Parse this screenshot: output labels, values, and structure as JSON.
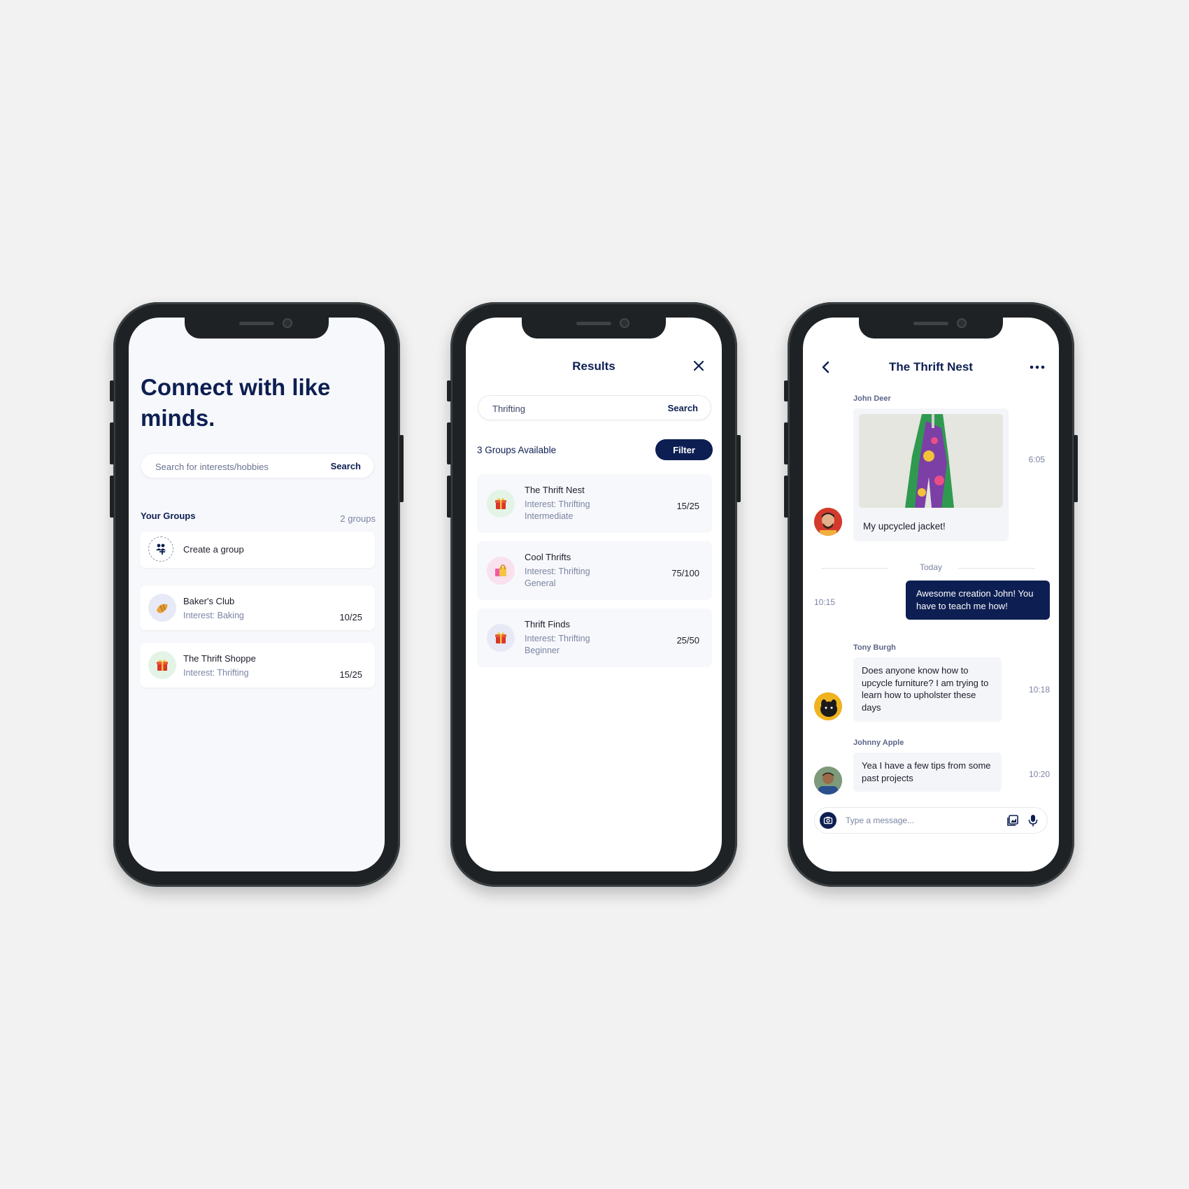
{
  "colors": {
    "navy": "#0d1f52",
    "muted_text": "#7b84a3",
    "card_bg": "#ffffff",
    "screen_bg": "#f7f8fb"
  },
  "screen1": {
    "title": "Connect with like minds.",
    "search": {
      "placeholder": "Search for interests/hobbies",
      "button": "Search"
    },
    "your_groups_label": "Your Groups",
    "groups_count": "2 groups",
    "create_group": {
      "label": "Create a group",
      "icon": "add-group-icon"
    },
    "groups": [
      {
        "name": "Baker's Club",
        "interest": "Interest: Baking",
        "members": "10/25",
        "icon": "croissant-icon"
      },
      {
        "name": "The Thrift Shoppe",
        "interest": "Interest: Thrifting",
        "members": "15/25",
        "icon": "gift-icon"
      }
    ]
  },
  "screen2": {
    "header": "Results",
    "search": {
      "value": "Thrifting",
      "button": "Search"
    },
    "available": "3 Groups Available",
    "filter": "Filter",
    "results": [
      {
        "name": "The Thrift Nest",
        "interest": "Interest: Thrifting",
        "level": "Intermediate",
        "members": "15/25",
        "icon": "gift-icon"
      },
      {
        "name": "Cool Thrifts",
        "interest": "Interest: Thrifting",
        "level": "General",
        "members": "75/100",
        "icon": "shopping-bags-icon"
      },
      {
        "name": "Thrift Finds",
        "interest": "Interest: Thrifting",
        "level": "Beginner",
        "members": "25/50",
        "icon": "gift-icon"
      }
    ]
  },
  "screen3": {
    "header": "The Thrift Nest",
    "messages": [
      {
        "sender": "John Deer",
        "text": "My upcycled jacket!",
        "time": "6:05",
        "has_image": true
      },
      {
        "text": "Awesome creation John! You have to teach me how!",
        "time": "10:15",
        "own": true
      },
      {
        "sender": "Tony Burgh",
        "text": "Does anyone know how to upcycle furniture? I am trying to learn how to upholster these days",
        "time": "10:18"
      },
      {
        "sender": "Johnny Apple",
        "text": "Yea I have a few tips from some past projects",
        "time": "10:20"
      }
    ],
    "divider": "Today",
    "input_placeholder": "Type a message..."
  }
}
